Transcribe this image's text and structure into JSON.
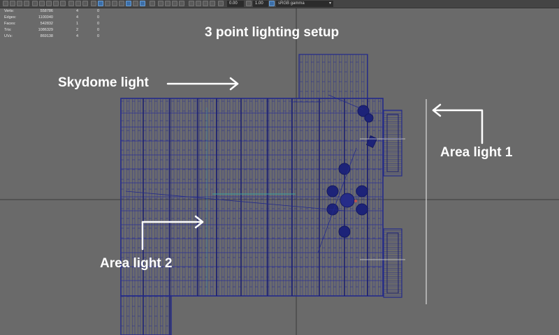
{
  "toolbar": {
    "field_a": "0.00",
    "field_b": "1.00",
    "color_space": "sRGB gamma"
  },
  "hud": {
    "rows": [
      {
        "label": "Verts:",
        "value": "558786",
        "sel": "4",
        "sel2": "0"
      },
      {
        "label": "Edges:",
        "value": "1100340",
        "sel": "4",
        "sel2": "0"
      },
      {
        "label": "Faces:",
        "value": "542832",
        "sel": "1",
        "sel2": "0"
      },
      {
        "label": "Tris:",
        "value": "1086329",
        "sel": "2",
        "sel2": "0"
      },
      {
        "label": "UVs:",
        "value": "869138",
        "sel": "4",
        "sel2": "0"
      }
    ]
  },
  "annotations": {
    "title": "3 point lighting setup",
    "skydome": "Skydome light",
    "area1": "Area light 1",
    "area2": "Area light 2"
  },
  "colors": {
    "viewport_bg": "#6a6a6a",
    "wireframe": "#232a8a",
    "annotation_text": "#ffffff"
  }
}
